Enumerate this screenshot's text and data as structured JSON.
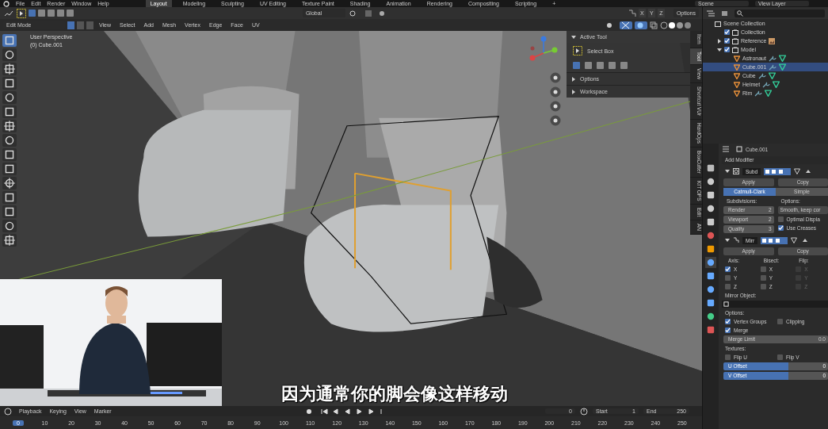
{
  "topbar": {
    "menus": [
      "File",
      "Edit",
      "Render",
      "Window",
      "Help"
    ],
    "workspaces": [
      {
        "label": "Layout",
        "selected": true
      },
      {
        "label": "Modeling",
        "selected": false
      },
      {
        "label": "Sculpting",
        "selected": false
      },
      {
        "label": "UV Editing",
        "selected": false
      },
      {
        "label": "Texture Paint",
        "selected": false
      },
      {
        "label": "Shading",
        "selected": false
      },
      {
        "label": "Animation",
        "selected": false
      },
      {
        "label": "Rendering",
        "selected": false
      },
      {
        "label": "Compositing",
        "selected": false
      },
      {
        "label": "Scripting",
        "selected": false
      }
    ],
    "add_workspace": "+",
    "scene": "Scene",
    "view_layer": "View Layer"
  },
  "header": {
    "transform_orientation": "Global",
    "axes": [
      "X",
      "Y",
      "Z"
    ],
    "options": "Options"
  },
  "mode_bar": {
    "mode": "Edit Mode",
    "select_modes": [
      {
        "selected": true
      },
      {
        "selected": false
      },
      {
        "selected": false
      }
    ],
    "menus": [
      "View",
      "Select",
      "Add",
      "Mesh",
      "Vertex",
      "Edge",
      "Face",
      "UV"
    ]
  },
  "viewport": {
    "view_name": "User Perspective",
    "object_name": "(0) Cube.001"
  },
  "toolbar": [
    {
      "selected": true
    },
    {
      "selected": false
    },
    {
      "selected": false
    },
    {
      "selected": false
    },
    {
      "selected": false
    },
    {
      "selected": false
    },
    {
      "selected": false
    },
    {
      "selected": false
    },
    {
      "selected": false
    },
    {
      "selected": false
    },
    {
      "selected": false
    },
    {
      "selected": false
    },
    {
      "selected": false
    },
    {
      "selected": false
    },
    {
      "selected": false
    }
  ],
  "active_tool_panel": {
    "title": "Active Tool",
    "tool": "Select Box",
    "sections": [
      "Options",
      "Workspace"
    ]
  },
  "sidebar_tabs": [
    {
      "label": "Item",
      "selected": false
    },
    {
      "label": "Tool",
      "selected": true
    },
    {
      "label": "View",
      "selected": false
    },
    {
      "label": "Shortcut VUr",
      "selected": false
    },
    {
      "label": "HardOps",
      "selected": false
    },
    {
      "label": "BoxCutter",
      "selected": false
    },
    {
      "label": "KIT OPS",
      "selected": false
    },
    {
      "label": "Edit",
      "selected": false
    },
    {
      "label": "AN",
      "selected": false
    }
  ],
  "subtitle": "因为通常你的脚会像这样移动",
  "outliner": {
    "root": "Scene Collection",
    "items": [
      {
        "label": "Collection",
        "checked": true
      },
      {
        "label": "Reference",
        "checked": true,
        "expanded": false
      },
      {
        "label": "Model",
        "checked": true,
        "expanded": true,
        "children": [
          {
            "label": "Astronaut",
            "selected": false
          },
          {
            "label": "Cube.001",
            "selected": true
          },
          {
            "label": "Cube",
            "selected": false
          },
          {
            "label": "Helmet",
            "selected": false
          },
          {
            "label": "Rim",
            "selected": false
          }
        ]
      }
    ]
  },
  "properties": {
    "object": "Cube.001",
    "add_modifier": "Add Modifier",
    "subd": {
      "name": "Subd",
      "apply": "Apply",
      "copy": "Copy",
      "types": [
        {
          "label": "Catmull-Clark",
          "selected": true
        },
        {
          "label": "Simple",
          "selected": false
        }
      ],
      "subdivisions_label": "Subdivisions:",
      "fields": [
        {
          "label": "Render",
          "value": "2"
        },
        {
          "label": "Viewport",
          "value": "2"
        },
        {
          "label": "Quality",
          "value": "3"
        }
      ],
      "options_label": "Options:",
      "uv_smooth": "Smooth, keep cor",
      "checks": [
        {
          "label": "Optimal Displa",
          "checked": false
        },
        {
          "label": "Use Creases",
          "checked": true
        }
      ]
    },
    "mirror": {
      "name": "Mirr",
      "apply": "Apply",
      "copy": "Copy",
      "columns": [
        {
          "title": "Axis:",
          "disabled": false,
          "items": [
            {
              "label": "X",
              "checked": true
            },
            {
              "label": "Y",
              "checked": false
            },
            {
              "label": "Z",
              "checked": false
            }
          ]
        },
        {
          "title": "Bisect:",
          "disabled": false,
          "items": [
            {
              "label": "X",
              "checked": false
            },
            {
              "label": "Y",
              "checked": false
            },
            {
              "label": "Z",
              "checked": false
            }
          ]
        },
        {
          "title": "Flip:",
          "disabled": true,
          "items": [
            {
              "label": "X",
              "checked": false
            },
            {
              "label": "Y",
              "checked": false
            },
            {
              "label": "Z",
              "checked": false
            }
          ]
        }
      ],
      "mirror_object_label": "Mirror Object:",
      "options_label": "Options:",
      "options": [
        {
          "label": "Vertex Groups",
          "checked": true
        },
        {
          "label": "Clipping",
          "checked": false
        },
        {
          "label": "Merge",
          "checked": true
        }
      ],
      "merge_limit": {
        "label": "Merge Limit",
        "value": "0.0"
      },
      "textures_label": "Textures:",
      "flips": [
        {
          "label": "Flip U",
          "checked": false
        },
        {
          "label": "Flip V",
          "checked": false
        }
      ],
      "offsets": [
        {
          "label": "U Offset",
          "value": "0"
        },
        {
          "label": "V Offset",
          "value": "0"
        }
      ]
    }
  },
  "timeline": {
    "menus": [
      "Playback",
      "Keying",
      "View",
      "Marker"
    ],
    "current_frame": "0",
    "start_label": "Start",
    "start": "1",
    "end_label": "End",
    "end": "250",
    "ticks": [
      {
        "label": "0",
        "selected": true
      },
      {
        "label": "10",
        "selected": false
      },
      {
        "label": "20",
        "selected": false
      },
      {
        "label": "30",
        "selected": false
      },
      {
        "label": "40",
        "selected": false
      },
      {
        "label": "50",
        "selected": false
      },
      {
        "label": "60",
        "selected": false
      },
      {
        "label": "70",
        "selected": false
      },
      {
        "label": "80",
        "selected": false
      },
      {
        "label": "90",
        "selected": false
      },
      {
        "label": "100",
        "selected": false
      },
      {
        "label": "110",
        "selected": false
      },
      {
        "label": "120",
        "selected": false
      },
      {
        "label": "130",
        "selected": false
      },
      {
        "label": "140",
        "selected": false
      },
      {
        "label": "150",
        "selected": false
      },
      {
        "label": "160",
        "selected": false
      },
      {
        "label": "170",
        "selected": false
      },
      {
        "label": "180",
        "selected": false
      },
      {
        "label": "190",
        "selected": false
      },
      {
        "label": "200",
        "selected": false
      },
      {
        "label": "210",
        "selected": false
      },
      {
        "label": "220",
        "selected": false
      },
      {
        "label": "230",
        "selected": false
      },
      {
        "label": "240",
        "selected": false
      },
      {
        "label": "250",
        "selected": false
      }
    ]
  }
}
